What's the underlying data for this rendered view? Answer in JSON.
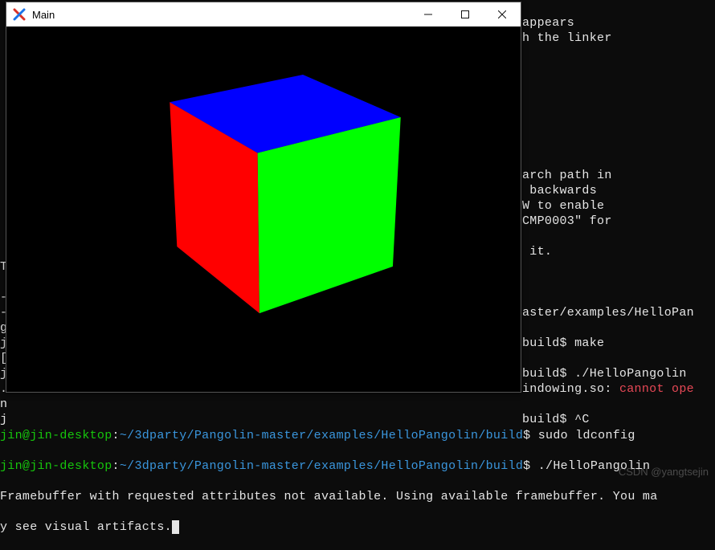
{
  "window": {
    "title": "Main",
    "minimize_label": "Minimize",
    "maximize_label": "Maximize",
    "close_label": "Close"
  },
  "terminal": {
    "top_right_lines": [
      "appears",
      "h the linker",
      "",
      "",
      "",
      "",
      "",
      "",
      "",
      "",
      "arch path in",
      " backwards",
      "W to enable",
      "CMP0003\" for",
      "",
      " it.",
      "",
      "",
      "",
      "aster/examples/HelloPan",
      "",
      "build$ make",
      "",
      "build$ ./HelloPangolin",
      "indowing.so:",
      "",
      "build$ ^C"
    ],
    "cannot_ope": "cannot ope",
    "left_col": {
      "T": "T",
      "dash": "-",
      "g": "g",
      "j": "j",
      "bracket": "[",
      "dot": ".",
      "n": "n",
      "jj": "j"
    },
    "prompt_lines": [
      {
        "user": "jin@jin-desktop",
        "colon": ":",
        "path": "~/3dparty/Pangolin-master/examples/HelloPangolin/build",
        "dollar": "$",
        "cmd": " sudo ldconfig"
      },
      {
        "user": "jin@jin-desktop",
        "colon": ":",
        "path": "~/3dparty/Pangolin-master/examples/HelloPangolin/build",
        "dollar": "$",
        "cmd": " ./HelloPangolin"
      }
    ],
    "tail_lines": [
      "Framebuffer with requested attributes not available. Using available framebuffer. You ma",
      "y see visual artifacts."
    ]
  },
  "watermark": "CSDN @yangtsejin",
  "cube": {
    "faces": {
      "top": "#0000ff",
      "left": "#ff0000",
      "front": "#00ff00"
    }
  }
}
